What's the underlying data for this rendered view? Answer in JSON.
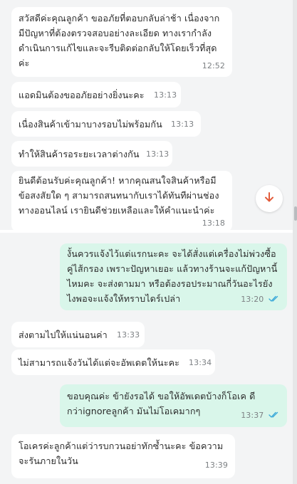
{
  "top_messages": [
    {
      "id": "m1",
      "direction": "incoming",
      "text": "สวัสดีค่ะคุณลูกค้า ขออภัยที่ตอบกลับล่าช้า เนื่องจากมีปัญหาที่ต้องตรวจสอบอย่างละเอียด ทางเรากำลังดำเนินการแก้ไขและจะรีบติดต่อกลับให้โดยเร็วที่สุดค่ะ",
      "time": "12:52"
    },
    {
      "id": "m2",
      "direction": "incoming",
      "text": "แอดมินต้องขออภัยอย่างยิ่งนะคะ",
      "time": "13:13"
    },
    {
      "id": "m3",
      "direction": "incoming",
      "text": "เนื่องสินค้าเข้ามาบางรอบไม่พร้อมกัน",
      "time": "13:13"
    },
    {
      "id": "m4",
      "direction": "incoming",
      "text": "ทำให้สินค้ารอระยะเวลาต่างกัน",
      "time": "13:13"
    },
    {
      "id": "m5",
      "direction": "incoming",
      "text": "ยินดีต้อนรับค่ะคุณลูกค้า! หากคุณสนใจสินค้าหรือมีข้อสงสัยใด ๆ สามารถสนทนากับเราได้ทันทีผ่านช่องทางออนไลน์ เรายินดีช่วยเหลือและให้คำแนะนำค่ะ",
      "time": "13:18"
    }
  ],
  "bottom_messages": [
    {
      "id": "m6",
      "direction": "outgoing",
      "text": "งั้นควรแจ้งไว้แต่แรกนะคะ จะได้สั่งแต่เครื่องไม่พ่วงซื้อคู่ไส้กรอง เพราะปัญหาเยอะ แล้วทางร้านจะแก้ปัญหานี้ไหมคะ จะส่งตามมา หรือต้องรอประมาณกี่วันอะไรยังไงพอจะแจ้งให้ทราบไดร์เปล่า",
      "time": "13:20",
      "read": true
    },
    {
      "id": "m7",
      "direction": "incoming",
      "text": "ส่งตามไปให้แน่นอนค่า",
      "time": "13:33"
    },
    {
      "id": "m8",
      "direction": "incoming",
      "text": "ไม่สามารถแจ้งวันได้แต่จะอัพเดตให้นะคะ",
      "time": "13:34"
    },
    {
      "id": "m9",
      "direction": "outgoing",
      "text": "ขอบคุณค่ะ ข้ายังรอได้ ขอให้อัพเดตบ้างก็โอเค ดีกว่าignoreลูกค้า มันไม่โอเคมากๆ",
      "time": "13:37",
      "read": true
    },
    {
      "id": "m10",
      "direction": "incoming",
      "text": "โอเครค่ะลูกค้าแต่ว่ารบกวนอย่าทักซ้ำนะคะ ข้อความจะรันภายในวัน",
      "time": "13:39"
    }
  ],
  "icons": {
    "scroll_down": "chevron-down-icon",
    "read_receipt": "double-check-icon"
  },
  "colors": {
    "incoming_bubble": "#ffffff",
    "outgoing_bubble": "#d9f6ea",
    "scroll_arrow": "#e25b3a",
    "read_tick": "#3aa8d9"
  }
}
